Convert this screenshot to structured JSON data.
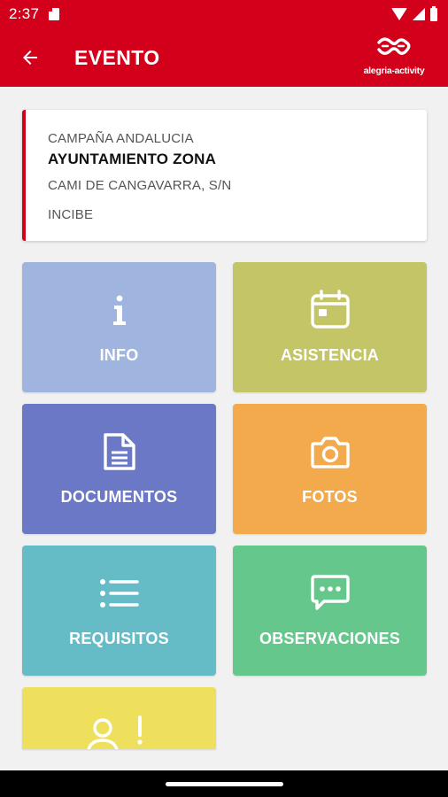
{
  "status_bar": {
    "time": "2:37"
  },
  "app_bar": {
    "title": "EVENTO",
    "brand": "alegria-activity"
  },
  "event": {
    "campaign": "CAMPAÑA ANDALUCIA",
    "name": "AYUNTAMIENTO ZONA",
    "address": "CAMI DE CANGAVARRA, S/N",
    "organizer": "INCIBE"
  },
  "tiles": [
    {
      "label": "INFO",
      "icon": "info-icon",
      "color": "#9fb4de"
    },
    {
      "label": "ASISTENCIA",
      "icon": "calendar-icon",
      "color": "#c3c566"
    },
    {
      "label": "DOCUMENTOS",
      "icon": "document-icon",
      "color": "#6a78c6"
    },
    {
      "label": "FOTOS",
      "icon": "camera-icon",
      "color": "#f2aa4c"
    },
    {
      "label": "REQUISITOS",
      "icon": "list-icon",
      "color": "#66bcc6"
    },
    {
      "label": "OBSERVACIONES",
      "icon": "chat-icon",
      "color": "#66c78d"
    },
    {
      "label": "",
      "icon": "user-alert-icon",
      "color": "#eee05c"
    }
  ],
  "colors": {
    "primary": "#d2001a",
    "background": "#f1f1f1"
  }
}
